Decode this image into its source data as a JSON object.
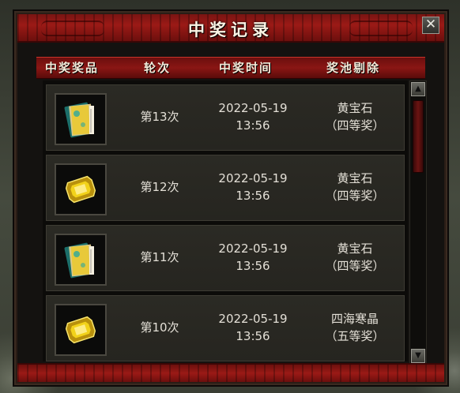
{
  "window": {
    "title": "中奖记录",
    "close_label": "✕"
  },
  "header": {
    "columns": [
      "中奖奖品",
      "轮次",
      "中奖时间",
      "奖池剔除"
    ]
  },
  "records": [
    {
      "item_icon": "book-icon",
      "round": "第13次",
      "date": "2022-05-19",
      "time": "13:56",
      "pool_item": "黄宝石",
      "pool_tier": "（四等奖）"
    },
    {
      "item_icon": "yellow-gem-icon",
      "round": "第12次",
      "date": "2022-05-19",
      "time": "13:56",
      "pool_item": "黄宝石",
      "pool_tier": "（四等奖）"
    },
    {
      "item_icon": "book-icon",
      "round": "第11次",
      "date": "2022-05-19",
      "time": "13:56",
      "pool_item": "黄宝石",
      "pool_tier": "（四等奖）"
    },
    {
      "item_icon": "yellow-gem-icon",
      "round": "第10次",
      "date": "2022-05-19",
      "time": "13:56",
      "pool_item": "四海寒晶",
      "pool_tier": "（五等奖）"
    }
  ],
  "scrollbar": {
    "up_label": "▲",
    "down_label": "▼"
  },
  "colors": {
    "title_red": "#9b1a16",
    "header_red": "#8a1614",
    "row_bg": "#2b2a24",
    "text": "#e3dfd6",
    "gem_yellow": "#f2d21a",
    "book_teal": "#2aa8a0"
  }
}
